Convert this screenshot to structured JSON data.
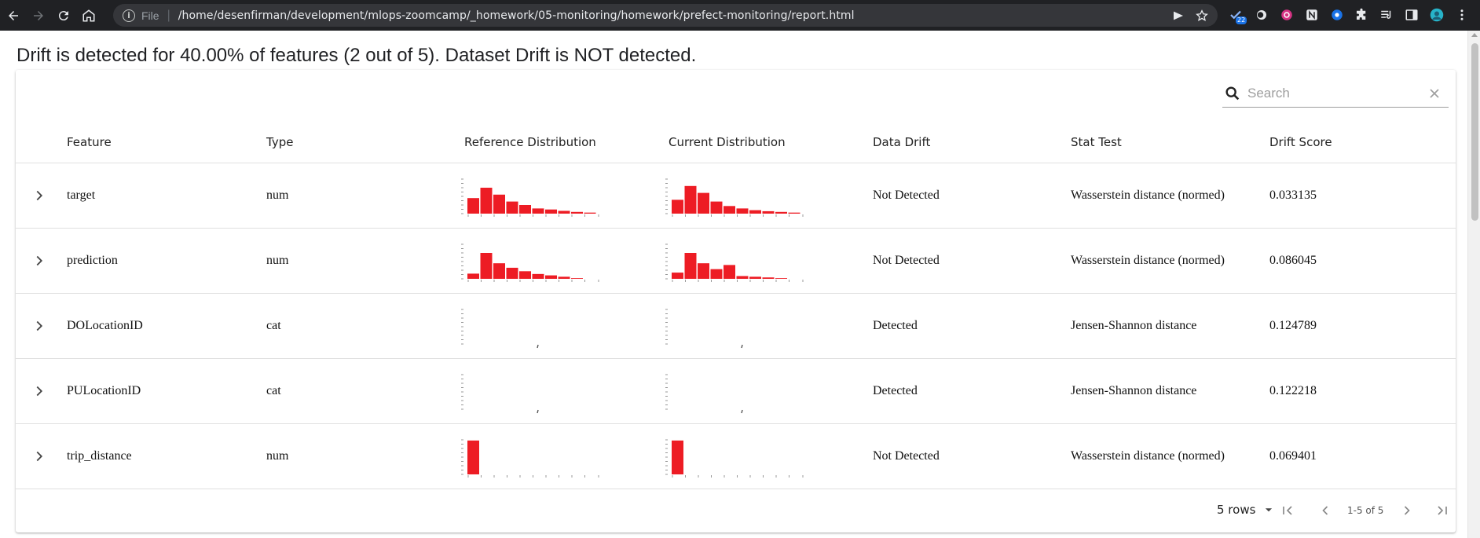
{
  "browser": {
    "scheme_label": "File",
    "url": "/home/desenfirman/development/mlops-zoomcamp/_homework/05-monitoring/homework/prefect-monitoring/report.html",
    "extension_badge": "22"
  },
  "report": {
    "headline": "Drift is detected for 40.00% of features (2 out of 5). Dataset Drift is NOT detected.",
    "search_placeholder": "Search",
    "columns": [
      "Feature",
      "Type",
      "Reference Distribution",
      "Current Distribution",
      "Data Drift",
      "Stat Test",
      "Drift Score"
    ],
    "rows": [
      {
        "feature": "target",
        "type": "num",
        "reference_hist": [
          0.45,
          0.75,
          0.55,
          0.35,
          0.25,
          0.15,
          0.12,
          0.08,
          0.05,
          0.03
        ],
        "current_hist": [
          0.4,
          0.8,
          0.6,
          0.35,
          0.22,
          0.15,
          0.1,
          0.07,
          0.05,
          0.03
        ],
        "data_drift": "Not Detected",
        "stat_test": "Wasserstein distance (normed)",
        "drift_score": "0.033135"
      },
      {
        "feature": "prediction",
        "type": "num",
        "reference_hist": [
          0.15,
          0.75,
          0.45,
          0.32,
          0.22,
          0.14,
          0.1,
          0.06,
          0.02,
          0.01
        ],
        "current_hist": [
          0.18,
          0.75,
          0.45,
          0.28,
          0.4,
          0.08,
          0.06,
          0.04,
          0.02,
          0.01
        ],
        "data_drift": "Not Detected",
        "stat_test": "Wasserstein distance (normed)",
        "drift_score": "0.086045"
      },
      {
        "feature": "DOLocationID",
        "type": "cat",
        "reference_hist": [],
        "current_hist": [],
        "data_drift": "Detected",
        "stat_test": "Jensen-Shannon distance",
        "drift_score": "0.124789"
      },
      {
        "feature": "PULocationID",
        "type": "cat",
        "reference_hist": [],
        "current_hist": [],
        "data_drift": "Detected",
        "stat_test": "Jensen-Shannon distance",
        "drift_score": "0.122218"
      },
      {
        "feature": "trip_distance",
        "type": "num",
        "reference_hist": [
          0.98,
          0,
          0,
          0,
          0,
          0,
          0,
          0,
          0,
          0
        ],
        "current_hist": [
          0.98,
          0,
          0,
          0,
          0,
          0,
          0,
          0,
          0,
          0
        ],
        "data_drift": "Not Detected",
        "stat_test": "Wasserstein distance (normed)",
        "drift_score": "0.069401"
      }
    ],
    "pagination": {
      "rows_per_page": "5 rows",
      "range": "1-5 of 5"
    },
    "colors": {
      "bar": "#ed1c24"
    }
  }
}
